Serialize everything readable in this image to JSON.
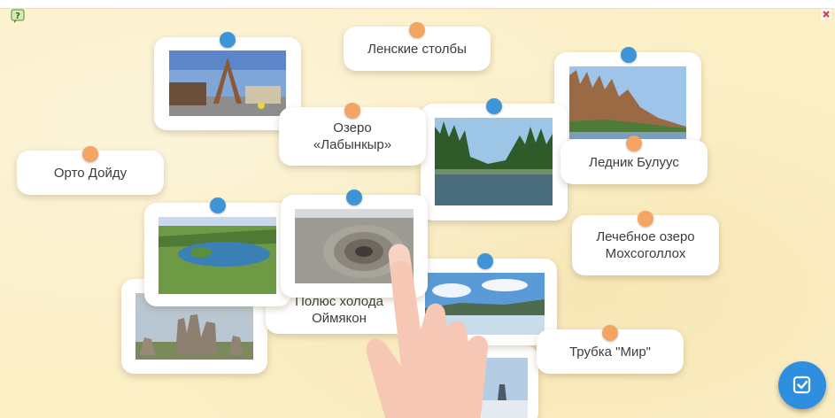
{
  "labels": {
    "lenskie_stolby": "Ленские столбы",
    "ozero_labynkyr_line1": "Озеро",
    "ozero_labynkyr_line2": "«Лабынкыр»",
    "orto_doidu": "Орто Дойду",
    "lednik_buluus": "Ледник Булуус",
    "ozero_mokhsogollokh_line1": "Лечебное озеро",
    "ozero_mokhsogollokh_line2": "Мохсоголлох",
    "polyus_kholoda_line1": "Полюс холода",
    "polyus_kholoda_line2": "Оймякон",
    "trubka_mir": "Трубка \"Мир\""
  },
  "photos": [
    "village-gate-photo",
    "lena-pillars-photo",
    "taiga-river-photo",
    "tundra-lake-photo",
    "mir-pit-photo",
    "rock-pillars-photo",
    "icy-river-photo",
    "frozen-port-photo"
  ],
  "colors": {
    "background": "#fbefc6",
    "blue_pin": "#3d94d6",
    "orange_pin": "#f4a463",
    "check_button": "#2e8fe0"
  },
  "icons": {
    "help": "help-icon",
    "close": "close-icon",
    "check": "check-icon",
    "hand": "pointing-hand-icon"
  }
}
